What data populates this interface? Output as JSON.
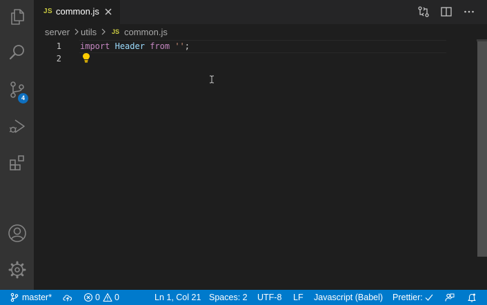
{
  "editor_tab": {
    "file_label": "JS",
    "file_name": "common.js"
  },
  "activity_bar": {
    "items": [
      {
        "icon": "files-icon"
      },
      {
        "icon": "search-icon"
      },
      {
        "icon": "source-control-icon",
        "badge": "4"
      },
      {
        "icon": "run-debug-icon"
      },
      {
        "icon": "extensions-icon"
      }
    ],
    "bottom": [
      {
        "icon": "account-icon"
      },
      {
        "icon": "gear-icon"
      }
    ]
  },
  "breadcrumb": {
    "parts": [
      "server",
      "utils"
    ],
    "file_label": "JS",
    "file_name": "common.js"
  },
  "code": {
    "lines": [
      {
        "number": "1",
        "tokens": {
          "kw1": "import",
          "id": "Header",
          "kw2": "from",
          "str": "''",
          "end": ";"
        }
      },
      {
        "number": "2"
      }
    ]
  },
  "status_bar": {
    "branch": "master*",
    "errors": "0",
    "warnings": "0",
    "position": "Ln 1, Col 21",
    "spaces": "Spaces: 2",
    "encoding": "UTF-8",
    "eol": "LF",
    "language": "Javascript (Babel)",
    "prettier": "Prettier:"
  },
  "colors": {
    "status_bar": "#007acc",
    "activity_bar": "#333333",
    "editor_bg": "#1e1e1e",
    "badge": "#0e70c0",
    "keyword": "#c586c0",
    "identifier": "#9cdcfe",
    "string": "#ce9178"
  }
}
